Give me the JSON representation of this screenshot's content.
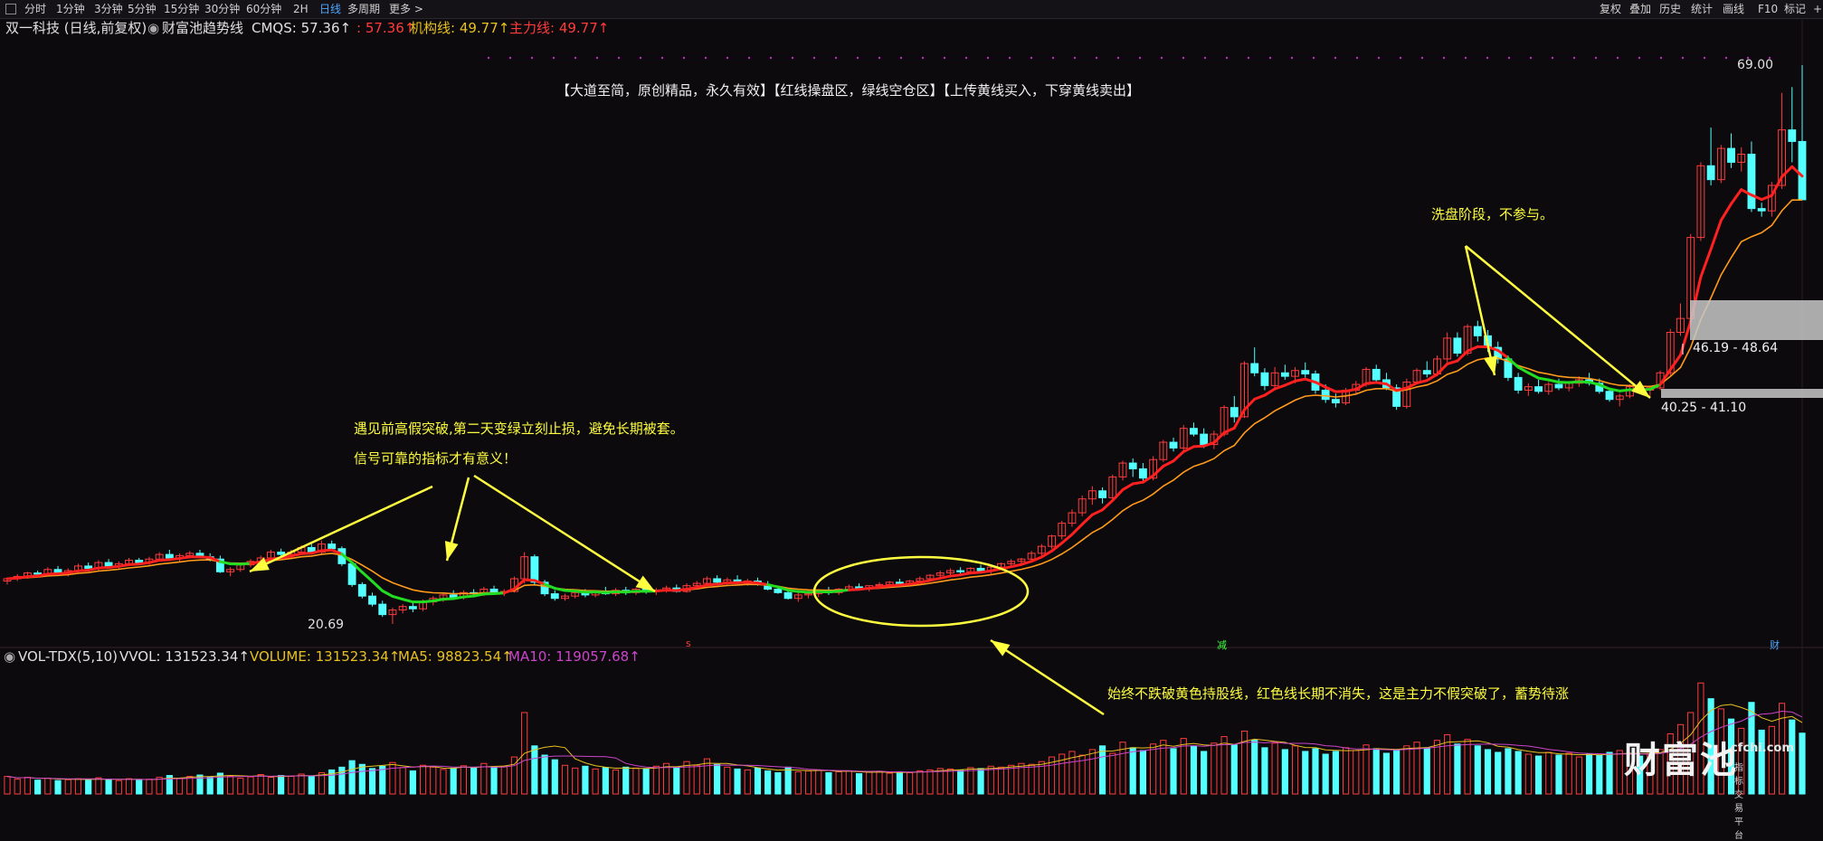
{
  "toolbar": {
    "timeframes": [
      "分时",
      "1分钟",
      "3分钟",
      "5分钟",
      "15分钟",
      "30分钟",
      "60分钟",
      "2H",
      "日线",
      "多周期",
      "更多 >"
    ],
    "active_timeframe": "日线",
    "right_items": [
      "复权",
      "叠加",
      "历史",
      "统计",
      "画线",
      "F10",
      "标记",
      "+"
    ]
  },
  "info": {
    "stock": "双一科技 (日线,前复权)",
    "indicator": "财富池趋势线",
    "cmqs": "CMQS: 57.36↑",
    "second": ": 57.36↑",
    "jigou": "机构线: 49.77↑",
    "zhuli": "主力线: 49.77↑"
  },
  "volume_header": {
    "name": "VOL-TDX(5,10)",
    "vvol": "VVOL: 131523.34↑",
    "volume": "VOLUME: 131523.34↑",
    "ma5": "MA5: 98823.54↑",
    "ma10": "MA10: 119057.68↑"
  },
  "annotations": {
    "banner": "【大道至简，原创精品，永久有效】【红线操盘区，绿线空仓区】【上传黄线买入，下穿黄线卖出】",
    "fake_break_1": "遇见前高假突破,第二天变绿立刻止损，避免长期被套。",
    "fake_break_2": "信号可靠的指标才有意义！",
    "wash": "洗盘阶段，不参与。",
    "hold": "始终不跌破黄色持股线，红色线长期不消失，这是主力不假突破了，蓄势待涨",
    "max_label": "69.00",
    "min_label": "20.69",
    "zone_upper": "46.19 - 48.64",
    "zone_lower": "40.25 - 41.10",
    "marker_s": "s",
    "marker_jian": "减",
    "marker_cai": "财"
  },
  "colors": {
    "up": "#ff3c3c",
    "down": "#54ffff",
    "bg": "#0c0a0d",
    "trend_red": "#ff2020",
    "trend_green": "#22dd22",
    "yellow_line": "#ff9a1a",
    "ma5": "#e8c020",
    "ma10": "#cc44cc",
    "annotation": "#ffff40"
  },
  "logo": {
    "text": "财富池",
    "url": "cfchi.com",
    "sub": "指标交易平台"
  },
  "chart_data": {
    "type": "candlestick",
    "price_range": [
      20.69,
      69.0
    ],
    "highest": 69.0,
    "lowest": 20.69,
    "candles": [
      [
        24.4,
        24.7,
        24.1,
        24.6
      ],
      [
        24.6,
        25.0,
        24.4,
        24.8
      ],
      [
        24.8,
        25.2,
        24.6,
        25.1
      ],
      [
        25.1,
        25.3,
        24.8,
        25.0
      ],
      [
        25.0,
        25.6,
        24.9,
        25.4
      ],
      [
        25.4,
        25.7,
        24.9,
        25.1
      ],
      [
        25.1,
        25.5,
        24.8,
        25.3
      ],
      [
        25.3,
        25.9,
        25.1,
        25.7
      ],
      [
        25.7,
        26.0,
        25.4,
        25.5
      ],
      [
        25.5,
        26.2,
        25.3,
        26.0
      ],
      [
        26.0,
        26.3,
        25.5,
        25.7
      ],
      [
        25.7,
        26.1,
        25.4,
        25.9
      ],
      [
        25.9,
        26.4,
        25.7,
        26.2
      ],
      [
        26.2,
        26.4,
        25.8,
        26.0
      ],
      [
        26.0,
        26.5,
        25.8,
        26.3
      ],
      [
        26.3,
        26.9,
        26.1,
        26.7
      ],
      [
        26.7,
        27.1,
        26.2,
        26.4
      ],
      [
        26.4,
        26.8,
        26.1,
        26.6
      ],
      [
        26.6,
        27.0,
        26.4,
        26.8
      ],
      [
        26.8,
        27.1,
        26.4,
        26.5
      ],
      [
        26.5,
        26.8,
        26.1,
        26.3
      ],
      [
        26.3,
        26.6,
        25.1,
        25.2
      ],
      [
        25.2,
        25.6,
        24.8,
        25.4
      ],
      [
        25.4,
        25.9,
        25.2,
        25.8
      ],
      [
        25.8,
        26.3,
        25.6,
        26.1
      ],
      [
        26.1,
        26.6,
        25.9,
        26.4
      ],
      [
        26.4,
        27.1,
        26.2,
        26.9
      ],
      [
        26.9,
        27.2,
        26.5,
        26.7
      ],
      [
        26.7,
        27.1,
        26.4,
        26.9
      ],
      [
        26.9,
        27.5,
        26.7,
        27.3
      ],
      [
        27.3,
        27.6,
        26.7,
        26.9
      ],
      [
        26.9,
        27.9,
        26.7,
        27.6
      ],
      [
        27.6,
        27.9,
        27.0,
        27.2
      ],
      [
        27.2,
        27.4,
        25.7,
        25.9
      ],
      [
        25.9,
        26.1,
        23.9,
        24.1
      ],
      [
        24.1,
        24.3,
        22.9,
        23.1
      ],
      [
        23.1,
        23.4,
        22.2,
        22.4
      ],
      [
        22.4,
        22.7,
        21.3,
        21.5
      ],
      [
        21.5,
        22.1,
        20.69,
        21.9
      ],
      [
        21.9,
        22.4,
        21.6,
        22.2
      ],
      [
        22.2,
        22.6,
        21.7,
        22.0
      ],
      [
        22.0,
        22.8,
        21.8,
        22.6
      ],
      [
        22.6,
        23.1,
        22.3,
        22.9
      ],
      [
        22.9,
        23.3,
        22.6,
        23.2
      ],
      [
        23.2,
        23.6,
        22.9,
        23.0
      ],
      [
        23.0,
        23.6,
        22.8,
        23.4
      ],
      [
        23.4,
        23.7,
        23.0,
        23.3
      ],
      [
        23.3,
        23.9,
        23.1,
        23.7
      ],
      [
        23.7,
        24.0,
        23.2,
        23.4
      ],
      [
        23.4,
        23.7,
        23.1,
        23.5
      ],
      [
        23.5,
        24.8,
        23.4,
        24.6
      ],
      [
        24.6,
        26.9,
        24.2,
        26.5
      ],
      [
        26.5,
        26.7,
        24.0,
        24.3
      ],
      [
        24.3,
        24.5,
        23.1,
        23.3
      ],
      [
        23.3,
        23.6,
        22.7,
        22.9
      ],
      [
        22.9,
        23.3,
        22.7,
        23.1
      ],
      [
        23.1,
        23.6,
        22.9,
        23.4
      ],
      [
        23.4,
        23.7,
        23.0,
        23.2
      ],
      [
        23.2,
        23.6,
        23.0,
        23.5
      ],
      [
        23.5,
        23.9,
        23.2,
        23.3
      ],
      [
        23.3,
        23.8,
        23.1,
        23.6
      ],
      [
        23.6,
        23.9,
        23.2,
        23.4
      ],
      [
        23.4,
        23.8,
        23.2,
        23.7
      ],
      [
        23.7,
        24.0,
        23.3,
        23.5
      ],
      [
        23.5,
        23.8,
        23.2,
        23.6
      ],
      [
        23.6,
        24.0,
        23.4,
        23.8
      ],
      [
        23.8,
        24.1,
        23.4,
        23.5
      ],
      [
        23.5,
        24.2,
        23.4,
        24.0
      ],
      [
        24.0,
        24.4,
        23.8,
        24.2
      ],
      [
        24.2,
        24.8,
        24.0,
        24.6
      ],
      [
        24.6,
        24.9,
        24.1,
        24.3
      ],
      [
        24.3,
        24.7,
        24.0,
        24.5
      ],
      [
        24.5,
        24.9,
        24.2,
        24.3
      ],
      [
        24.3,
        24.6,
        24.0,
        24.4
      ],
      [
        24.4,
        24.7,
        24.0,
        24.1
      ],
      [
        24.1,
        24.4,
        23.6,
        23.7
      ],
      [
        23.7,
        24.0,
        23.3,
        23.4
      ],
      [
        23.4,
        23.6,
        22.8,
        22.9
      ],
      [
        22.9,
        23.4,
        22.6,
        23.2
      ],
      [
        23.2,
        23.6,
        22.9,
        23.3
      ],
      [
        23.3,
        23.7,
        23.0,
        23.6
      ],
      [
        23.6,
        23.9,
        23.2,
        23.4
      ],
      [
        23.4,
        23.8,
        23.2,
        23.7
      ],
      [
        23.7,
        24.1,
        23.5,
        23.9
      ],
      [
        23.9,
        24.2,
        23.6,
        23.8
      ],
      [
        23.8,
        24.0,
        23.5,
        24.0
      ],
      [
        24.0,
        24.3,
        23.8,
        24.1
      ],
      [
        24.1,
        24.4,
        23.8,
        24.3
      ],
      [
        24.3,
        24.6,
        24.0,
        24.2
      ],
      [
        24.2,
        24.5,
        24.0,
        24.4
      ],
      [
        24.4,
        24.8,
        24.2,
        24.6
      ],
      [
        24.6,
        25.0,
        24.4,
        24.9
      ],
      [
        24.9,
        25.3,
        24.6,
        25.1
      ],
      [
        25.1,
        25.5,
        24.9,
        25.3
      ],
      [
        25.3,
        25.6,
        25.0,
        25.2
      ],
      [
        25.2,
        25.6,
        25.0,
        25.5
      ],
      [
        25.5,
        25.8,
        25.1,
        25.3
      ],
      [
        25.3,
        25.7,
        25.0,
        25.6
      ],
      [
        25.6,
        26.0,
        25.4,
        25.9
      ],
      [
        25.9,
        26.3,
        25.6,
        26.1
      ],
      [
        26.1,
        26.4,
        25.8,
        26.3
      ],
      [
        26.3,
        27.0,
        26.1,
        26.8
      ],
      [
        26.8,
        27.6,
        26.6,
        27.4
      ],
      [
        27.4,
        28.4,
        27.2,
        28.3
      ],
      [
        28.3,
        29.6,
        28.0,
        29.4
      ],
      [
        29.4,
        30.6,
        29.1,
        30.3
      ],
      [
        30.3,
        31.8,
        30.0,
        31.5
      ],
      [
        31.5,
        32.6,
        31.0,
        32.2
      ],
      [
        32.2,
        32.5,
        31.1,
        31.6
      ],
      [
        31.6,
        33.6,
        31.4,
        33.4
      ],
      [
        33.4,
        34.8,
        33.1,
        34.6
      ],
      [
        34.6,
        35.0,
        33.4,
        34.1
      ],
      [
        34.1,
        34.6,
        32.9,
        33.3
      ],
      [
        33.3,
        35.2,
        33.1,
        34.9
      ],
      [
        34.9,
        36.6,
        34.7,
        36.4
      ],
      [
        36.4,
        36.8,
        35.6,
        35.9
      ],
      [
        35.9,
        37.9,
        35.7,
        37.6
      ],
      [
        37.6,
        38.1,
        36.9,
        37.1
      ],
      [
        37.1,
        37.6,
        35.9,
        36.2
      ],
      [
        36.2,
        37.4,
        35.8,
        37.1
      ],
      [
        37.1,
        39.6,
        36.9,
        39.4
      ],
      [
        39.4,
        40.4,
        38.1,
        38.6
      ],
      [
        38.6,
        43.4,
        38.5,
        43.2
      ],
      [
        43.2,
        44.6,
        42.1,
        42.4
      ],
      [
        42.4,
        42.8,
        40.9,
        41.3
      ],
      [
        41.3,
        42.9,
        41.0,
        42.4
      ],
      [
        42.4,
        43.1,
        41.8,
        42.1
      ],
      [
        42.1,
        42.9,
        41.5,
        42.6
      ],
      [
        42.6,
        43.3,
        42.0,
        42.3
      ],
      [
        42.3,
        42.6,
        40.6,
        40.9
      ],
      [
        40.9,
        41.4,
        39.8,
        40.1
      ],
      [
        40.1,
        40.6,
        39.4,
        39.8
      ],
      [
        39.8,
        41.1,
        39.6,
        40.9
      ],
      [
        40.9,
        41.7,
        40.6,
        41.4
      ],
      [
        41.4,
        42.9,
        41.2,
        42.7
      ],
      [
        42.7,
        43.1,
        41.5,
        41.8
      ],
      [
        41.8,
        42.4,
        40.9,
        41.1
      ],
      [
        41.1,
        41.4,
        39.2,
        39.5
      ],
      [
        39.5,
        41.9,
        39.3,
        41.6
      ],
      [
        41.6,
        42.8,
        41.4,
        42.6
      ],
      [
        42.6,
        43.4,
        42.0,
        42.3
      ],
      [
        42.3,
        43.9,
        42.1,
        43.6
      ],
      [
        43.6,
        45.9,
        43.3,
        45.4
      ],
      [
        45.4,
        45.9,
        43.8,
        44.1
      ],
      [
        44.1,
        46.6,
        43.9,
        46.4
      ],
      [
        46.4,
        46.9,
        45.1,
        45.6
      ],
      [
        45.6,
        46.1,
        44.2,
        44.6
      ],
      [
        44.6,
        45.1,
        43.2,
        43.6
      ],
      [
        43.6,
        43.9,
        41.7,
        42.0
      ],
      [
        42.0,
        42.4,
        40.6,
        40.9
      ],
      [
        40.9,
        41.5,
        40.4,
        41.2
      ],
      [
        41.2,
        41.8,
        40.6,
        40.8
      ],
      [
        40.8,
        41.6,
        40.5,
        41.4
      ],
      [
        41.4,
        41.9,
        40.9,
        41.1
      ],
      [
        41.1,
        41.7,
        40.8,
        41.5
      ],
      [
        41.5,
        42.1,
        41.2,
        41.8
      ],
      [
        41.8,
        42.4,
        41.3,
        41.5
      ],
      [
        41.5,
        41.9,
        40.6,
        40.8
      ],
      [
        40.8,
        41.1,
        39.9,
        40.1
      ],
      [
        40.1,
        40.6,
        39.5,
        40.4
      ],
      [
        40.4,
        41.4,
        40.2,
        41.2
      ],
      [
        41.2,
        41.6,
        40.6,
        40.9
      ],
      [
        40.9,
        41.3,
        40.4,
        41.1
      ],
      [
        41.1,
        42.6,
        40.9,
        42.4
      ],
      [
        42.4,
        46.2,
        42.2,
        45.9
      ],
      [
        45.9,
        48.4,
        45.6,
        47.1
      ],
      [
        47.1,
        54.4,
        46.8,
        54.1
      ],
      [
        54.1,
        60.6,
        53.8,
        60.3
      ],
      [
        60.3,
        63.6,
        58.6,
        59.1
      ],
      [
        59.1,
        62.1,
        58.8,
        61.8
      ],
      [
        61.8,
        63.1,
        60.1,
        60.6
      ],
      [
        60.6,
        61.9,
        59.8,
        61.3
      ],
      [
        61.3,
        62.4,
        56.3,
        56.6
      ],
      [
        56.6,
        57.1,
        55.9,
        56.4
      ],
      [
        56.4,
        58.9,
        55.9,
        58.6
      ],
      [
        58.6,
        66.6,
        58.3,
        63.4
      ],
      [
        63.4,
        67.1,
        60.6,
        62.4
      ],
      [
        62.4,
        69.0,
        61.6,
        57.36
      ]
    ],
    "volume_range": [
      0,
      260000
    ],
    "volume": [
      38000,
      32000,
      36000,
      30000,
      34000,
      29000,
      31000,
      33000,
      30000,
      35000,
      31000,
      29000,
      33000,
      30000,
      32000,
      36000,
      40000,
      34000,
      38000,
      41000,
      37000,
      45000,
      39000,
      34000,
      37000,
      42000,
      36000,
      40000,
      38000,
      43000,
      39000,
      46000,
      52000,
      58000,
      72000,
      64000,
      55000,
      60000,
      68000,
      57000,
      50000,
      62000,
      58000,
      53000,
      56000,
      61000,
      57000,
      66000,
      58000,
      60000,
      80000,
      176000,
      104000,
      84000,
      74000,
      62000,
      56000,
      60000,
      54000,
      57000,
      52000,
      58000,
      56000,
      54000,
      60000,
      66000,
      58000,
      70000,
      62000,
      76000,
      64000,
      58000,
      54000,
      52000,
      56000,
      50000,
      46000,
      58000,
      48000,
      50000,
      52000,
      46000,
      48000,
      50000,
      44000,
      47000,
      49000,
      45000,
      48000,
      46000,
      50000,
      52000,
      55000,
      54000,
      51000,
      57000,
      55000,
      60000,
      58000,
      62000,
      66000,
      64000,
      70000,
      80000,
      86000,
      92000,
      84000,
      96000,
      104000,
      88000,
      112000,
      100000,
      94000,
      108000,
      116000,
      98000,
      120000,
      104000,
      92000,
      110000,
      124000,
      106000,
      136000,
      116000,
      100000,
      110000,
      96000,
      104000,
      92000,
      98000,
      86000,
      92000,
      100000,
      94000,
      106000,
      98000,
      88000,
      96000,
      104000,
      112000,
      100000,
      116000,
      128000,
      108000,
      118000,
      104000,
      96000,
      90000,
      98000,
      92000,
      86000,
      82000,
      90000,
      84000,
      88000,
      80000,
      86000,
      84000,
      90000,
      94000,
      86000,
      82000,
      88000,
      96000,
      130000,
      150000,
      176000,
      240000,
      206000,
      184000,
      162000,
      142000,
      198000,
      138000,
      146000,
      196000,
      160000,
      131523.34
    ],
    "volume_ma5_last": 98823.54,
    "volume_ma10_last": 119057.68
  }
}
